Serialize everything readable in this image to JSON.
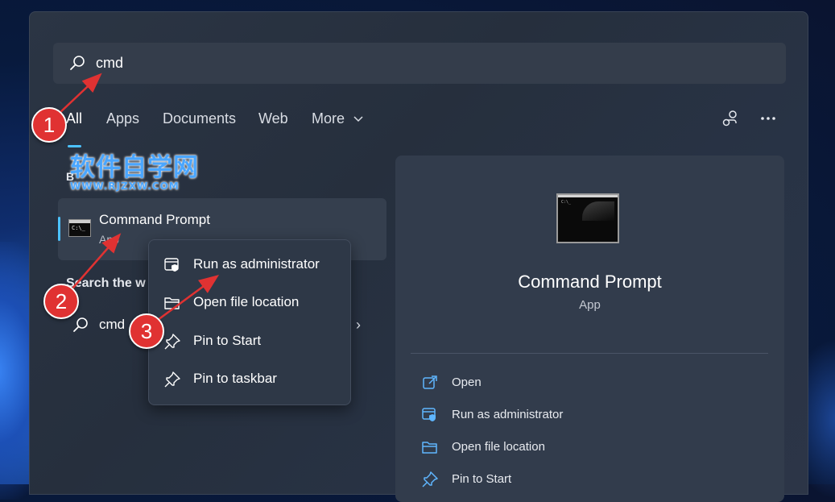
{
  "search": {
    "value": "cmd"
  },
  "tabs": [
    {
      "label": "All"
    },
    {
      "label": "Apps"
    },
    {
      "label": "Documents"
    },
    {
      "label": "Web"
    },
    {
      "label": "More"
    }
  ],
  "watermark": {
    "line1": "软件自学网",
    "line2": "WWW.RJZXW.COM"
  },
  "best_match": {
    "section_label": "B",
    "title": "Command Prompt",
    "subtitle": "App"
  },
  "web_search": {
    "section_label": "Search the w",
    "query": "cmd"
  },
  "context_menu": [
    {
      "label": "Run as administrator",
      "icon": "shield-window-icon"
    },
    {
      "label": "Open file location",
      "icon": "folder-icon"
    },
    {
      "label": "Pin to Start",
      "icon": "pin-icon"
    },
    {
      "label": "Pin to taskbar",
      "icon": "pin-icon"
    }
  ],
  "preview": {
    "title": "Command Prompt",
    "subtitle": "App",
    "actions": [
      {
        "label": "Open",
        "icon": "open-external-icon"
      },
      {
        "label": "Run as administrator",
        "icon": "shield-window-icon"
      },
      {
        "label": "Open file location",
        "icon": "folder-icon"
      },
      {
        "label": "Pin to Start",
        "icon": "pin-icon"
      }
    ]
  },
  "callouts": [
    "1",
    "2",
    "3"
  ],
  "colors": {
    "accent": "#4cc2ff",
    "callout": "#e03232",
    "arrow": "#e03232"
  }
}
